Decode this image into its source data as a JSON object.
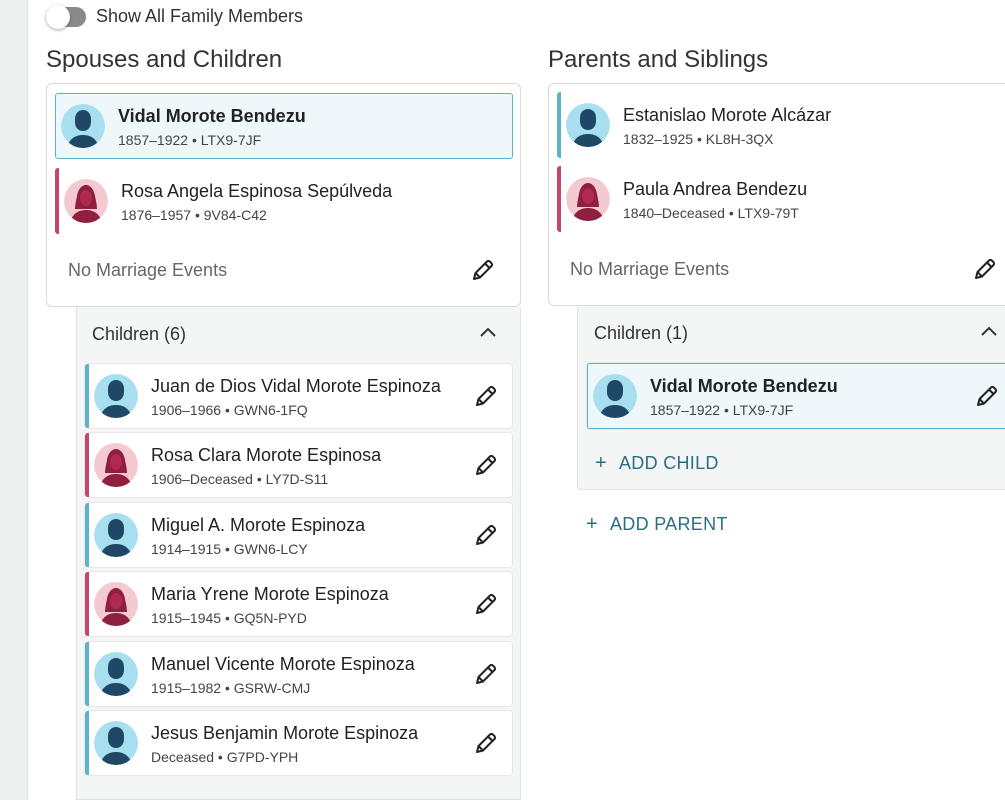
{
  "toggle": {
    "label": "Show All Family Members",
    "on": false
  },
  "spouses_section": {
    "title": "Spouses and Children",
    "couple": [
      {
        "name": "Vidal Morote Bendezu",
        "meta": "1857–1922 • LTX9-7JF",
        "gender": "male",
        "selected": true
      },
      {
        "name": "Rosa Angela Espinosa Sepúlveda",
        "meta": "1876–1957 • 9V84-C42",
        "gender": "female",
        "selected": false
      }
    ],
    "marriage_events": "No Marriage Events",
    "children_header": "Children (6)",
    "children": [
      {
        "name": "Juan de Dios Vidal Morote Espinoza",
        "meta": "1906–1966 • GWN6-1FQ",
        "gender": "male"
      },
      {
        "name": "Rosa Clara Morote Espinosa",
        "meta": "1906–Deceased • LY7D-S11",
        "gender": "female"
      },
      {
        "name": "Miguel A. Morote Espinoza",
        "meta": "1914–1915 • GWN6-LCY",
        "gender": "male"
      },
      {
        "name": "Maria Yrene Morote Espinoza",
        "meta": "1915–1945 • GQ5N-PYD",
        "gender": "female"
      },
      {
        "name": "Manuel Vicente Morote Espinoza",
        "meta": "1915–1982 • GSRW-CMJ",
        "gender": "male"
      },
      {
        "name": "Jesus Benjamin Morote Espinoza",
        "meta": "Deceased • G7PD-YPH",
        "gender": "male"
      }
    ]
  },
  "parents_section": {
    "title": "Parents and Siblings",
    "couple": [
      {
        "name": "Estanislao Morote Alcázar",
        "meta": "1832–1925 • KL8H-3QX",
        "gender": "male"
      },
      {
        "name": "Paula Andrea Bendezu",
        "meta": "1840–Deceased • LTX9-79T",
        "gender": "female"
      }
    ],
    "marriage_events": "No Marriage Events",
    "children_header": "Children (1)",
    "children": [
      {
        "name": "Vidal Morote Bendezu",
        "meta": "1857–1922 • LTX9-7JF",
        "gender": "male",
        "selected": true
      }
    ],
    "add_child_label": "ADD CHILD",
    "add_parent_label": "ADD PARENT"
  },
  "colors": {
    "male_accent": "#5bb3c9",
    "female_accent": "#c6466a",
    "link": "#2b6e87",
    "selected_bg": "#eef7fa"
  },
  "icons": [
    "male-avatar-icon",
    "female-avatar-icon",
    "pencil-icon",
    "chevron-up-icon",
    "plus-icon"
  ]
}
